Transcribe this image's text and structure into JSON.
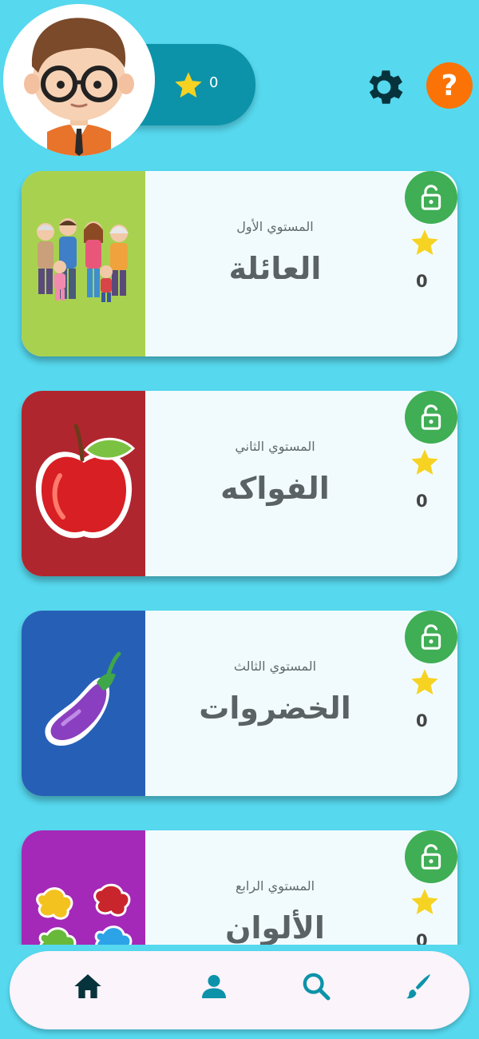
{
  "header": {
    "stars_total": "0",
    "colors": {
      "accent": "#0c93a9",
      "help": "#fb7307",
      "background": "#56d8ee"
    },
    "icons": {
      "avatar": "boy-with-glasses-avatar",
      "settings": "gear-icon",
      "help": "help-icon"
    }
  },
  "levels": [
    {
      "subtitle": "المستوي الأول",
      "title": "العائلة",
      "stars": "0",
      "thumb_color": "#a8d150",
      "thumb_icon": "family-icon"
    },
    {
      "subtitle": "المستوي الثاني",
      "title": "الفواكه",
      "stars": "0",
      "thumb_color": "#b0262f",
      "thumb_icon": "apple-icon"
    },
    {
      "subtitle": "المستوي الثالث",
      "title": "الخضروات",
      "stars": "0",
      "thumb_color": "#2660b6",
      "thumb_icon": "eggplant-icon"
    },
    {
      "subtitle": "المستوي الرابع",
      "title": "الألوان",
      "stars": "0",
      "thumb_color": "#a429b8",
      "thumb_icon": "paint-splash-icon"
    }
  ],
  "nav": {
    "items": [
      {
        "name": "home",
        "icon": "home-icon",
        "active": true
      },
      {
        "name": "profile",
        "icon": "person-icon",
        "active": false
      },
      {
        "name": "search",
        "icon": "search-icon",
        "active": false
      },
      {
        "name": "draw",
        "icon": "brush-icon",
        "active": false
      }
    ]
  }
}
